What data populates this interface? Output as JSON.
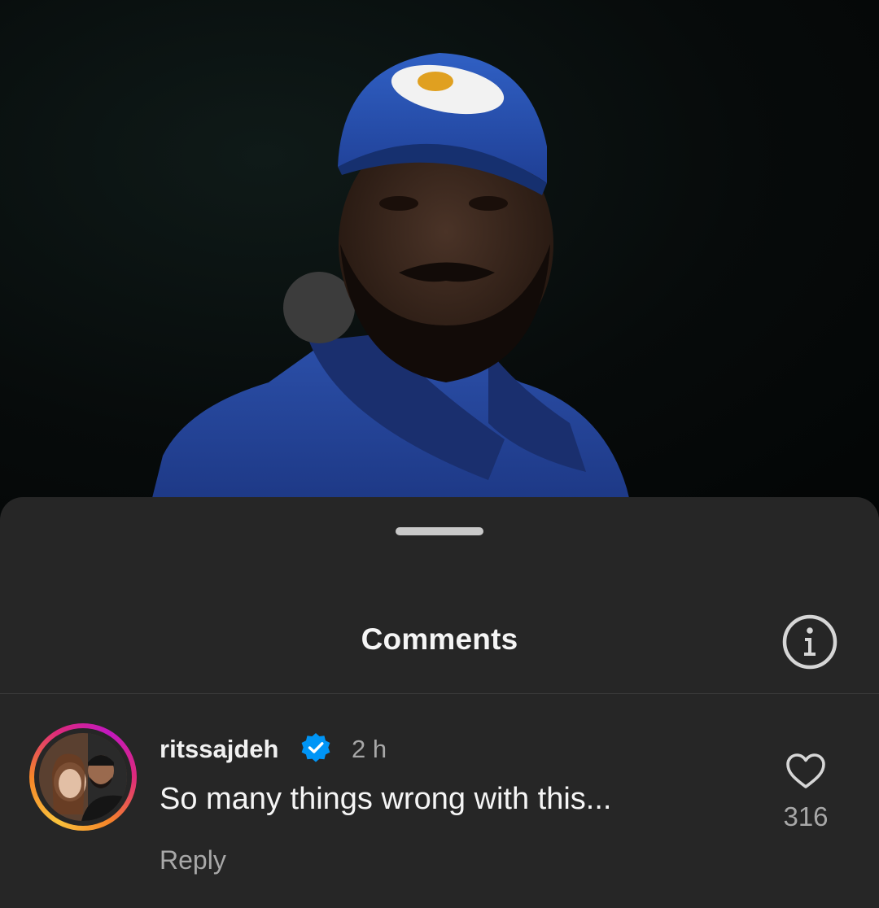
{
  "sheet": {
    "title": "Comments",
    "info_icon": "info-circle-icon"
  },
  "comments": [
    {
      "username": "ritssajdeh",
      "verified": true,
      "time": "2 h",
      "text": "So many things wrong with this...",
      "reply_label": "Reply",
      "like_count": "316",
      "like_icon": "heart-outline-icon"
    }
  ],
  "colors": {
    "sheet_bg": "#262626",
    "text_primary": "#f5f5f5",
    "text_secondary": "#a8a8a8",
    "verified_blue": "#0095f6"
  }
}
